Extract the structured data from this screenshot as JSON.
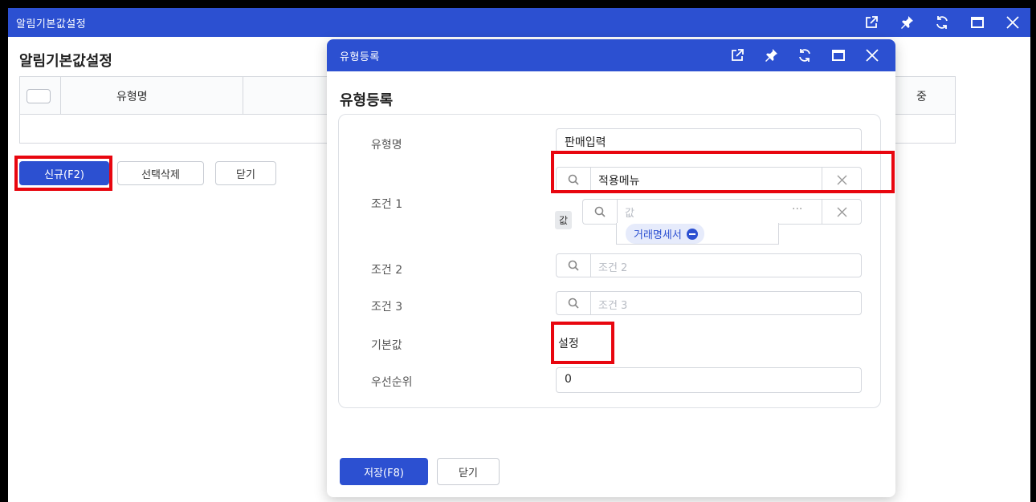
{
  "window": {
    "title": "알림기본값설정",
    "icons": [
      "popout-icon",
      "pin-icon",
      "refresh-icon",
      "maximize-icon",
      "close-icon"
    ]
  },
  "page": {
    "heading": "알림기본값설정",
    "grid": {
      "columns": [
        "유형명",
        "중"
      ]
    },
    "buttons": {
      "new": "신규(F2)",
      "delete_selected": "선택삭제",
      "close": "닫기"
    }
  },
  "modal": {
    "title": "유형등록",
    "heading": "유형등록",
    "form": {
      "type_name": {
        "label": "유형명",
        "value": "판매입력"
      },
      "apply_menu": {
        "placeholder": "적용메뉴"
      },
      "condition1": {
        "label": "조건 1",
        "value_tag": "값",
        "placeholder": "값",
        "dots": "···",
        "chip": "거래명세서"
      },
      "condition2": {
        "label": "조건 2",
        "placeholder": "조건 2"
      },
      "condition3": {
        "label": "조건 3",
        "placeholder": "조건 3"
      },
      "default_value": {
        "label": "기본값",
        "value": "설정"
      },
      "priority": {
        "label": "우선순위",
        "value": "0"
      }
    },
    "buttons": {
      "save": "저장(F8)",
      "close": "닫기"
    }
  },
  "colors": {
    "primary": "#2c50d1",
    "highlight": "#e8060f",
    "border": "#d5d8de"
  }
}
